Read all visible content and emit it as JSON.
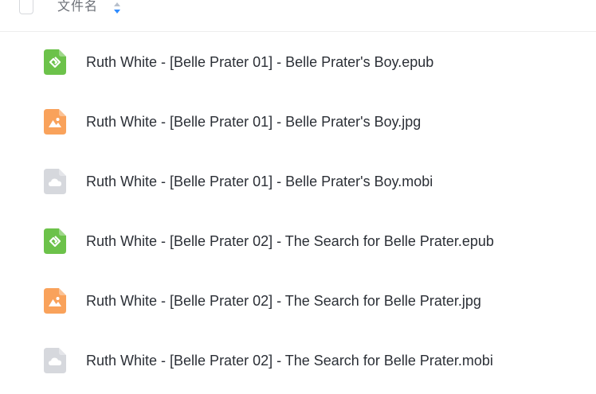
{
  "header": {
    "column_label": "文件名"
  },
  "files": [
    {
      "name": "Ruth White - [Belle Prater 01] - Belle Prater's Boy.epub",
      "icon": "epub-file-icon",
      "color": "#6cc24a"
    },
    {
      "name": "Ruth White - [Belle Prater 01] - Belle Prater's Boy.jpg",
      "icon": "image-file-icon",
      "color": "#f9a25b"
    },
    {
      "name": "Ruth White - [Belle Prater 01] - Belle Prater's Boy.mobi",
      "icon": "generic-file-icon",
      "color": "#d6d8dd"
    },
    {
      "name": "Ruth White - [Belle Prater 02] - The Search for Belle Prater.epub",
      "icon": "epub-file-icon",
      "color": "#6cc24a"
    },
    {
      "name": "Ruth White - [Belle Prater 02] - The Search for Belle Prater.jpg",
      "icon": "image-file-icon",
      "color": "#f9a25b"
    },
    {
      "name": "Ruth White - [Belle Prater 02] - The Search for Belle Prater.mobi",
      "icon": "generic-file-icon",
      "color": "#d6d8dd"
    }
  ],
  "colors": {
    "sort_up": "#b8c0cc",
    "sort_down": "#2f8cff"
  }
}
